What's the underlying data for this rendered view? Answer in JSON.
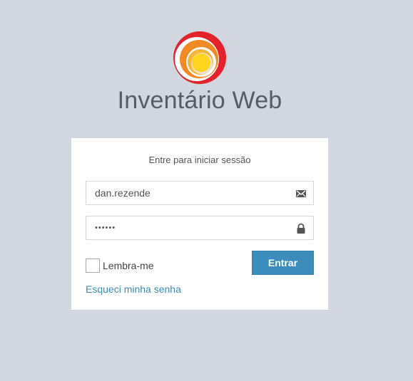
{
  "brand": {
    "title": "Inventário Web",
    "logo_icon": "sun-swirl-logo",
    "logo_colors": {
      "outer": "#e4222c",
      "middle": "#f08a24",
      "inner": "#ffd41e"
    }
  },
  "login": {
    "message": "Entre para iniciar sessão",
    "username": {
      "value": "dan.rezende",
      "icon": "envelope-icon"
    },
    "password": {
      "value": "••••••",
      "icon": "lock-icon"
    },
    "remember_label": "Lembra-me",
    "remember_checked": false,
    "submit_label": "Entrar",
    "forgot_label": "Esqueci minha senha"
  },
  "colors": {
    "background": "#d2d6de",
    "accent": "#3c8dbc",
    "box": "#ffffff"
  }
}
